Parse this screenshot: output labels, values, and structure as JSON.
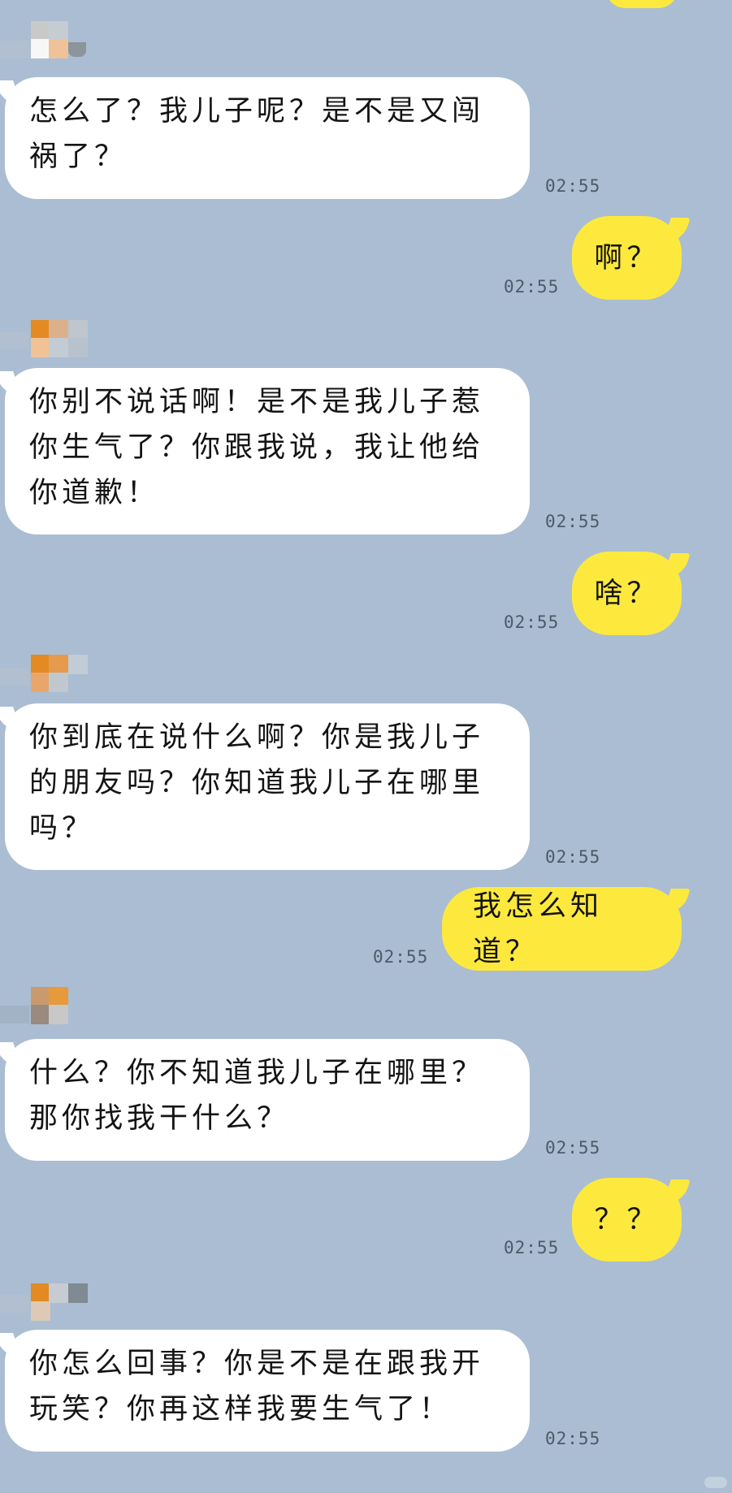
{
  "conversation": {
    "messages": [
      {
        "side": "in",
        "text": "怎么了？我儿子呢？是不是又闯祸了？",
        "time": "02:55"
      },
      {
        "side": "out",
        "text": "啊？",
        "time": "02:55"
      },
      {
        "side": "in",
        "text": "你别不说话啊！是不是我儿子惹你生气了？你跟我说，我让他给你道歉！",
        "time": "02:55"
      },
      {
        "side": "out",
        "text": "啥？",
        "time": "02:55"
      },
      {
        "side": "in",
        "text": "你到底在说什么啊？你是我儿子的朋友吗？你知道我儿子在哪里吗？",
        "time": "02:55"
      },
      {
        "side": "out",
        "text": "我怎么知道？",
        "time": "02:55"
      },
      {
        "side": "in",
        "text": "什么？你不知道我儿子在哪里？那你找我干什么？",
        "time": "02:55"
      },
      {
        "side": "out",
        "text": "？？",
        "time": "02:55"
      },
      {
        "side": "in",
        "text": "你怎么回事？你是不是在跟我开玩笑？你再这样我要生气了！",
        "time": "02:55"
      }
    ]
  },
  "avatar_icon": "pixelated-avatar-icon",
  "colors": {
    "background": "#aabdd2",
    "incoming_bubble": "#ffffff",
    "outgoing_bubble": "#fde93e",
    "timestamp": "#4c5a69"
  }
}
